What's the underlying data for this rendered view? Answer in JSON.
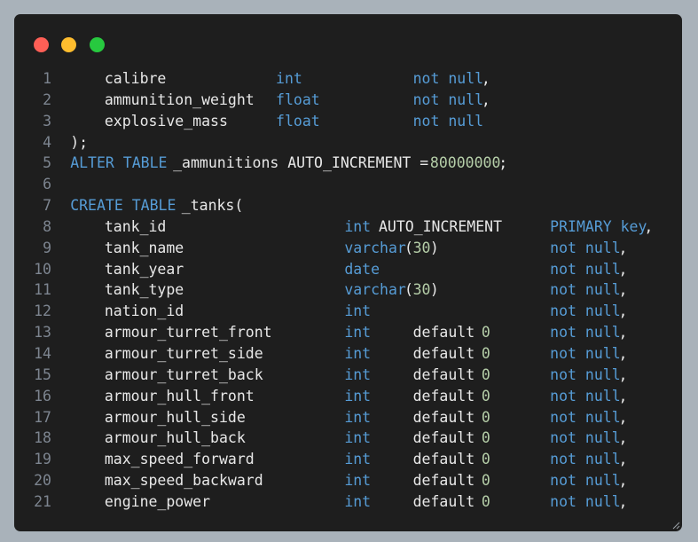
{
  "window": {
    "traffic_lights": [
      {
        "name": "close",
        "color": "#ff5f56"
      },
      {
        "name": "minimize",
        "color": "#ffbd2e"
      },
      {
        "name": "maximize",
        "color": "#27c93f"
      }
    ]
  },
  "colors": {
    "background": "#a9b2ba",
    "editor": "#1e1e1e",
    "text": "#e8e8e8",
    "keyword": "#569cd6",
    "number": "#b5cea8",
    "line_number": "#7d8590"
  },
  "code": {
    "lines": [
      {
        "num": "1",
        "tokens": [
          {
            "text": "calibre",
            "style": "txt",
            "col": 4
          },
          {
            "text": "int",
            "style": "kw",
            "col": 24
          },
          {
            "text": "not null",
            "style": "kw",
            "col": 40
          },
          {
            "text": ",",
            "style": "txt",
            "col": 48
          }
        ]
      },
      {
        "num": "2",
        "tokens": [
          {
            "text": "ammunition_weight",
            "style": "txt",
            "col": 4
          },
          {
            "text": "float",
            "style": "kw",
            "col": 24
          },
          {
            "text": "not null",
            "style": "kw",
            "col": 40
          },
          {
            "text": ",",
            "style": "txt",
            "col": 48
          }
        ]
      },
      {
        "num": "3",
        "tokens": [
          {
            "text": "explosive_mass",
            "style": "txt",
            "col": 4
          },
          {
            "text": "float",
            "style": "kw",
            "col": 24
          },
          {
            "text": "not null",
            "style": "kw",
            "col": 40
          }
        ]
      },
      {
        "num": "4",
        "tokens": [
          {
            "text": ");",
            "style": "txt",
            "col": 0
          }
        ]
      },
      {
        "num": "5",
        "tokens": [
          {
            "text": "ALTER TABLE",
            "style": "kw",
            "col": 0
          },
          {
            "text": "_ammunitions AUTO_INCREMENT =",
            "style": "txt",
            "col": 12
          },
          {
            "text": "80000000",
            "style": "num",
            "col": 42
          },
          {
            "text": ";",
            "style": "txt",
            "col": 50
          }
        ]
      },
      {
        "num": "6",
        "tokens": []
      },
      {
        "num": "7",
        "tokens": [
          {
            "text": "CREATE TABLE",
            "style": "kw",
            "col": 0
          },
          {
            "text": "_tanks(",
            "style": "txt",
            "col": 13
          }
        ]
      },
      {
        "num": "8",
        "tokens": [
          {
            "text": "tank_id",
            "style": "txt",
            "col": 4
          },
          {
            "text": "int",
            "style": "kw",
            "col": 32
          },
          {
            "text": "AUTO_INCREMENT",
            "style": "txt",
            "col": 36
          },
          {
            "text": "PRIMARY key",
            "style": "kw",
            "col": 56
          },
          {
            "text": ",",
            "style": "txt",
            "col": 67
          }
        ]
      },
      {
        "num": "9",
        "tokens": [
          {
            "text": "tank_name",
            "style": "txt",
            "col": 4
          },
          {
            "text": "varchar",
            "style": "kw",
            "col": 32
          },
          {
            "text": "(",
            "style": "txt",
            "col": 39
          },
          {
            "text": "30",
            "style": "num",
            "col": 40
          },
          {
            "text": ")",
            "style": "txt",
            "col": 42
          },
          {
            "text": "not null",
            "style": "kw",
            "col": 56
          },
          {
            "text": ",",
            "style": "txt",
            "col": 64
          }
        ]
      },
      {
        "num": "10",
        "tokens": [
          {
            "text": "tank_year",
            "style": "txt",
            "col": 4
          },
          {
            "text": "date",
            "style": "kw",
            "col": 32
          },
          {
            "text": "not null",
            "style": "kw",
            "col": 56
          },
          {
            "text": ",",
            "style": "txt",
            "col": 64
          }
        ]
      },
      {
        "num": "11",
        "tokens": [
          {
            "text": "tank_type",
            "style": "txt",
            "col": 4
          },
          {
            "text": "varchar",
            "style": "kw",
            "col": 32
          },
          {
            "text": "(",
            "style": "txt",
            "col": 39
          },
          {
            "text": "30",
            "style": "num",
            "col": 40
          },
          {
            "text": ")",
            "style": "txt",
            "col": 42
          },
          {
            "text": "not null",
            "style": "kw",
            "col": 56
          },
          {
            "text": ",",
            "style": "txt",
            "col": 64
          }
        ]
      },
      {
        "num": "12",
        "tokens": [
          {
            "text": "nation_id",
            "style": "txt",
            "col": 4
          },
          {
            "text": "int",
            "style": "kw",
            "col": 32
          },
          {
            "text": "not null",
            "style": "kw",
            "col": 56
          },
          {
            "text": ",",
            "style": "txt",
            "col": 64
          }
        ]
      },
      {
        "num": "13",
        "tokens": [
          {
            "text": "armour_turret_front",
            "style": "txt",
            "col": 4
          },
          {
            "text": "int",
            "style": "kw",
            "col": 32
          },
          {
            "text": "default",
            "style": "txt",
            "col": 40
          },
          {
            "text": "0",
            "style": "num",
            "col": 48
          },
          {
            "text": "not null",
            "style": "kw",
            "col": 56
          },
          {
            "text": ",",
            "style": "txt",
            "col": 64
          }
        ]
      },
      {
        "num": "14",
        "tokens": [
          {
            "text": "armour_turret_side",
            "style": "txt",
            "col": 4
          },
          {
            "text": "int",
            "style": "kw",
            "col": 32
          },
          {
            "text": "default",
            "style": "txt",
            "col": 40
          },
          {
            "text": "0",
            "style": "num",
            "col": 48
          },
          {
            "text": "not null",
            "style": "kw",
            "col": 56
          },
          {
            "text": ",",
            "style": "txt",
            "col": 64
          }
        ]
      },
      {
        "num": "15",
        "tokens": [
          {
            "text": "armour_turret_back",
            "style": "txt",
            "col": 4
          },
          {
            "text": "int",
            "style": "kw",
            "col": 32
          },
          {
            "text": "default",
            "style": "txt",
            "col": 40
          },
          {
            "text": "0",
            "style": "num",
            "col": 48
          },
          {
            "text": "not null",
            "style": "kw",
            "col": 56
          },
          {
            "text": ",",
            "style": "txt",
            "col": 64
          }
        ]
      },
      {
        "num": "16",
        "tokens": [
          {
            "text": "armour_hull_front",
            "style": "txt",
            "col": 4
          },
          {
            "text": "int",
            "style": "kw",
            "col": 32
          },
          {
            "text": "default",
            "style": "txt",
            "col": 40
          },
          {
            "text": "0",
            "style": "num",
            "col": 48
          },
          {
            "text": "not null",
            "style": "kw",
            "col": 56
          },
          {
            "text": ",",
            "style": "txt",
            "col": 64
          }
        ]
      },
      {
        "num": "17",
        "tokens": [
          {
            "text": "armour_hull_side",
            "style": "txt",
            "col": 4
          },
          {
            "text": "int",
            "style": "kw",
            "col": 32
          },
          {
            "text": "default",
            "style": "txt",
            "col": 40
          },
          {
            "text": "0",
            "style": "num",
            "col": 48
          },
          {
            "text": "not null",
            "style": "kw",
            "col": 56
          },
          {
            "text": ",",
            "style": "txt",
            "col": 64
          }
        ]
      },
      {
        "num": "18",
        "tokens": [
          {
            "text": "armour_hull_back",
            "style": "txt",
            "col": 4
          },
          {
            "text": "int",
            "style": "kw",
            "col": 32
          },
          {
            "text": "default",
            "style": "txt",
            "col": 40
          },
          {
            "text": "0",
            "style": "num",
            "col": 48
          },
          {
            "text": "not null",
            "style": "kw",
            "col": 56
          },
          {
            "text": ",",
            "style": "txt",
            "col": 64
          }
        ]
      },
      {
        "num": "19",
        "tokens": [
          {
            "text": "max_speed_forward",
            "style": "txt",
            "col": 4
          },
          {
            "text": "int",
            "style": "kw",
            "col": 32
          },
          {
            "text": "default",
            "style": "txt",
            "col": 40
          },
          {
            "text": "0",
            "style": "num",
            "col": 48
          },
          {
            "text": "not null",
            "style": "kw",
            "col": 56
          },
          {
            "text": ",",
            "style": "txt",
            "col": 64
          }
        ]
      },
      {
        "num": "20",
        "tokens": [
          {
            "text": "max_speed_backward",
            "style": "txt",
            "col": 4
          },
          {
            "text": "int",
            "style": "kw",
            "col": 32
          },
          {
            "text": "default",
            "style": "txt",
            "col": 40
          },
          {
            "text": "0",
            "style": "num",
            "col": 48
          },
          {
            "text": "not null",
            "style": "kw",
            "col": 56
          },
          {
            "text": ",",
            "style": "txt",
            "col": 64
          }
        ]
      },
      {
        "num": "21",
        "tokens": [
          {
            "text": "engine_power",
            "style": "txt",
            "col": 4
          },
          {
            "text": "int",
            "style": "kw",
            "col": 32
          },
          {
            "text": "default",
            "style": "txt",
            "col": 40
          },
          {
            "text": "0",
            "style": "num",
            "col": 48
          },
          {
            "text": "not null",
            "style": "kw",
            "col": 56
          },
          {
            "text": ",",
            "style": "txt",
            "col": 64
          }
        ]
      }
    ]
  }
}
